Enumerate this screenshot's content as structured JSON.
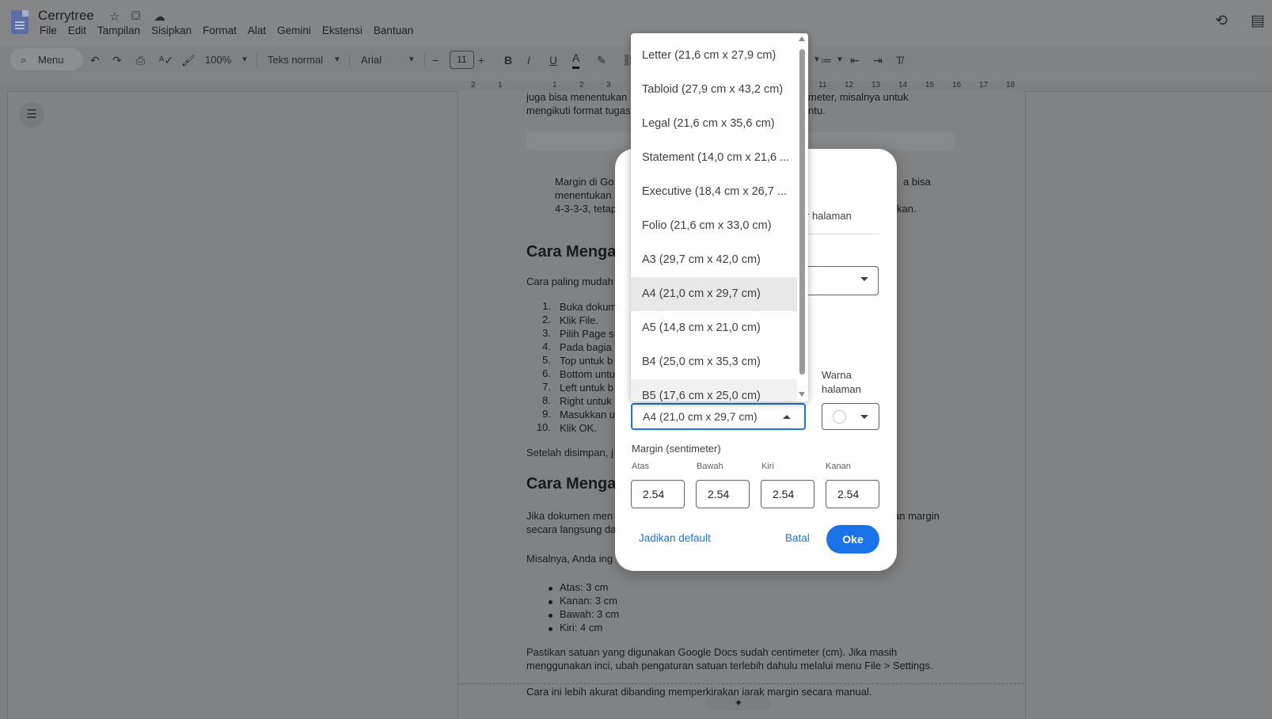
{
  "app": {
    "doc_title": "Cerrytree",
    "menu": [
      "File",
      "Edit",
      "Tampilan",
      "Sisipkan",
      "Format",
      "Alat",
      "Gemini",
      "Ekstensi",
      "Bantuan"
    ]
  },
  "toolbar": {
    "search_label": "Menu",
    "zoom": "100%",
    "style": "Teks normal",
    "font": "Arial",
    "font_size": "11"
  },
  "ruler": {
    "ticks": [
      "2",
      "1",
      "1",
      "2",
      "3",
      "11",
      "12",
      "13",
      "14",
      "15",
      "16",
      "17",
      "18"
    ]
  },
  "document": {
    "top_lines": [
      {
        "left": "juga bisa menentukan",
        "right": "meter, misalnya untuk"
      },
      {
        "left": "mengikuti format tugas",
        "right": "ntu."
      }
    ],
    "quote": [
      {
        "left": "Margin di Go",
        "right": "a bisa"
      },
      {
        "left": "menentukan",
        "right": ""
      },
      {
        "left": "4-3-3-3, tetap",
        "right": "kan."
      }
    ],
    "heading1": "Cara Menga",
    "intro": "Cara paling mudah",
    "steps": [
      "Buka dokum",
      "Klik File.",
      "Pilih Page s",
      "Pada bagia",
      "Top untuk b",
      "Bottom untu",
      "Left untuk b",
      "Right untuk",
      "Masukkan u",
      "Klik OK."
    ],
    "after_steps": "Setelah disimpan, j",
    "heading2": "Cara Menga",
    "heading2_tail": "I",
    "para2": [
      {
        "left": "Jika dokumen men",
        "right": "an margin"
      },
      {
        "left": "secara langsung da",
        "right": ""
      }
    ],
    "para3": "Misalnya, Anda ing",
    "bullets": [
      "Atas: 3 cm",
      "Kanan: 3 cm",
      "Bawah: 3 cm",
      "Kiri: 4 cm"
    ],
    "para4": [
      "Pastikan satuan yang digunakan Google Docs sudah centimeter (cm). Jika masih",
      "menggunakan inci, ubah pengaturan satuan terlebih dahulu melalui menu File > Settings."
    ],
    "para5": "Cara ini lebih akurat dibanding memperkirakan jarak margin secara manual.",
    "sparkle": "✦"
  },
  "dialog": {
    "tab_fragment": "r halaman",
    "page_color_label": "Warna halaman",
    "paper_size_value": "A4 (21,0 cm x 29,7 cm)",
    "margin_title": "Margin (sentimeter)",
    "margins": [
      {
        "label": "Atas",
        "value": "2.54"
      },
      {
        "label": "Bawah",
        "value": "2.54"
      },
      {
        "label": "Kiri",
        "value": "2.54"
      },
      {
        "label": "Kanan",
        "value": "2.54"
      }
    ],
    "set_default": "Jadikan default",
    "cancel": "Batal",
    "ok": "Oke"
  },
  "paper_options": [
    "Letter (21,6 cm x 27,9 cm)",
    "Tabloid (27,9 cm x 43,2 cm)",
    "Legal (21,6 cm x 35,6 cm)",
    "Statement (14,0 cm x 21,6 ...",
    "Executive (18,4 cm x 26,7 ...",
    "Folio (21,6 cm x 33,0 cm)",
    "A3 (29,7 cm x 42,0 cm)",
    "A4 (21,0 cm x 29,7 cm)",
    "A5 (14,8 cm x 21,0 cm)",
    "B4 (25,0 cm x 35,3 cm)",
    "B5 (17,6 cm x 25,0 cm)"
  ],
  "paper_selected": "A4 (21,0 cm x 29,7 cm)",
  "colors": {
    "accent": "#1a73e8",
    "scrim": "#808284"
  }
}
